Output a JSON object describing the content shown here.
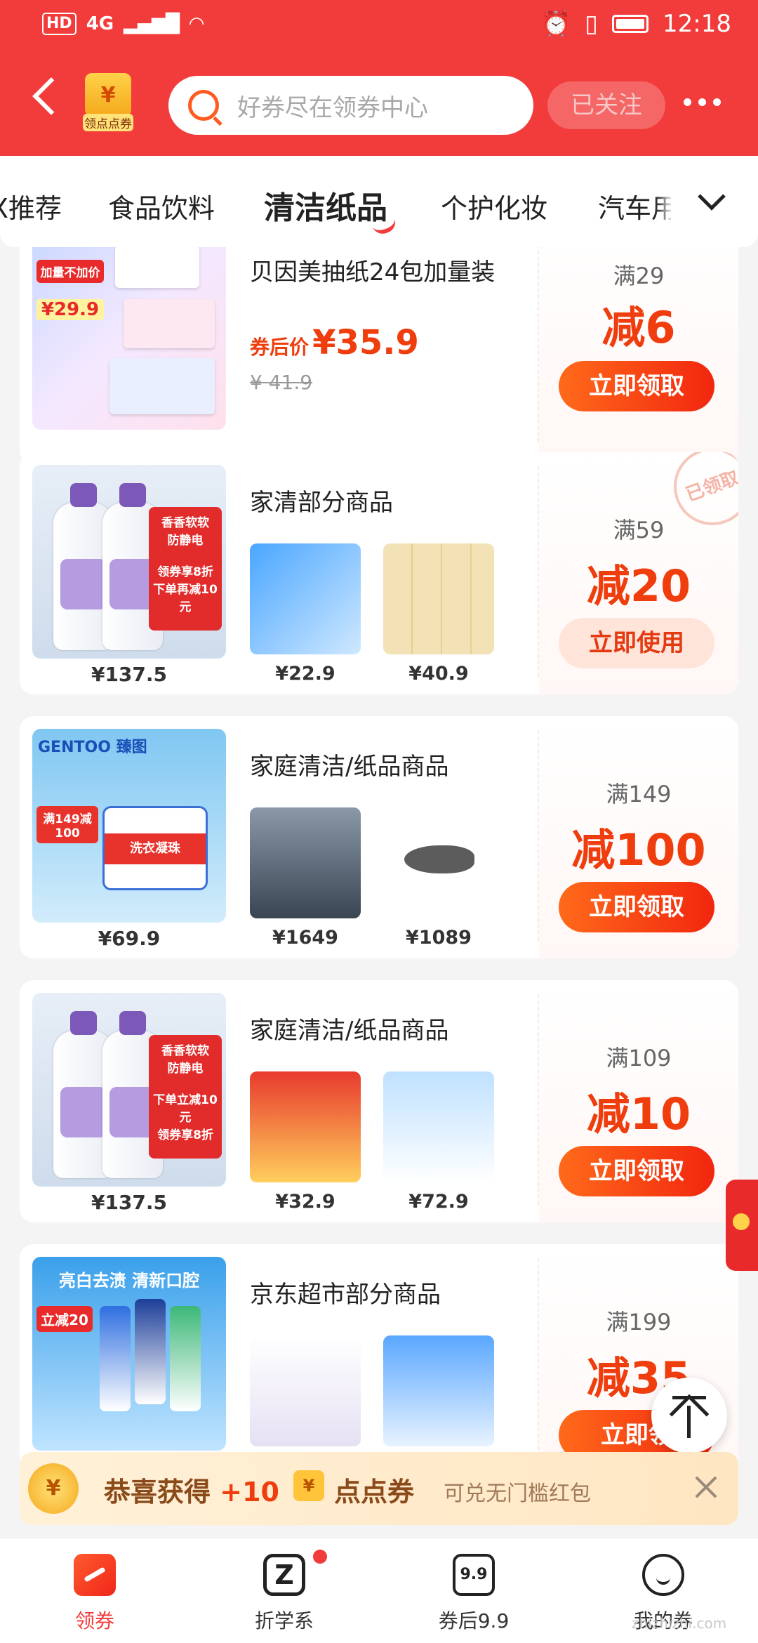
{
  "status_bar": {
    "hd": "HD",
    "network": "4G",
    "time": "12:18"
  },
  "header": {
    "logo_label": "领点点券",
    "search_placeholder": "好券尽在领券中心",
    "follow_label": "已关注"
  },
  "tabs": [
    {
      "label": "X推荐",
      "active": false
    },
    {
      "label": "食品饮料",
      "active": false
    },
    {
      "label": "清洁纸品",
      "active": true
    },
    {
      "label": "个护化妆",
      "active": false
    },
    {
      "label": "汽车用",
      "active": false
    }
  ],
  "cards": [
    {
      "title": "贝因美抽纸24包加量装",
      "promo_tag": "加量不加价",
      "promo_price": "¥29.9",
      "after_coupon_label": "券后价",
      "after_coupon_price": "¥35.9",
      "original_price": "¥ 41.9",
      "threshold": "满29",
      "discount": "减6",
      "button": "立即领取"
    },
    {
      "title": "家清部分商品",
      "main_price": "¥137.5",
      "thumb_prices": [
        "¥22.9",
        "¥40.9"
      ],
      "threshold": "满59",
      "discount": "减20",
      "button": "立即使用",
      "stamp": "已领取"
    },
    {
      "title": "家庭清洁/纸品商品",
      "main_price": "¥69.9",
      "brand": "GENTOO 臻图",
      "thumb_prices": [
        "¥1649",
        "¥1089"
      ],
      "threshold": "满149",
      "discount": "减100",
      "button": "立即领取"
    },
    {
      "title": "家庭清洁/纸品商品",
      "main_price": "¥137.5",
      "thumb_prices": [
        "¥32.9",
        "¥72.9"
      ],
      "threshold": "满109",
      "discount": "减10",
      "button": "立即领取"
    },
    {
      "title": "京东超市部分商品",
      "main_price": "",
      "promo_text": "亮白去渍 清新口腔",
      "thumb_prices": [
        "",
        ""
      ],
      "threshold": "满199",
      "discount": "减35",
      "button": "立即领"
    }
  ],
  "banner": {
    "message_a": "恭喜获得 ",
    "message_b": "+10",
    "message_c": "点点券",
    "sub": "可兑无门槛红包"
  },
  "nav": [
    {
      "label": "领券",
      "icon": "coupon-icon",
      "active": true
    },
    {
      "label": "折学系",
      "icon": "z-icon",
      "active": false,
      "has_dot": true
    },
    {
      "label": "券后9.9",
      "icon": "nine-nine-icon",
      "active": false,
      "icon_text": "9.9"
    },
    {
      "label": "我的券",
      "icon": "profile-icon",
      "active": false
    }
  ],
  "watermark": "zhizhizhi.com",
  "colors": {
    "brand_red": "#f23b3b",
    "discount_orange": "#f03d0e"
  }
}
